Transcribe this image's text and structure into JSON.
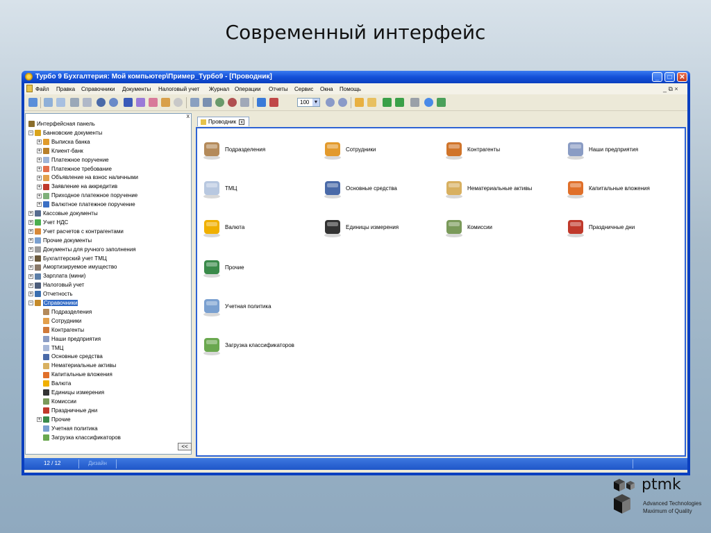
{
  "slide": {
    "title": "Современный интерфейс"
  },
  "window": {
    "title": "Турбо 9 Бухгалтерия: Мой компьютер\\Пример_Турбо9 - [Проводник]",
    "buttons": {
      "minimize": "_",
      "maximize": "□",
      "close": "✕"
    }
  },
  "menu": {
    "items": [
      "Файл",
      "Правка",
      "Справочники",
      "Документы",
      "Налоговый учет",
      "Журнал",
      "Операции",
      "Отчеты",
      "Сервис",
      "Окна",
      "Помощь"
    ],
    "mdi_controls": "_ ⧉ ×"
  },
  "toolbar": {
    "zoom_value": "100"
  },
  "tree": {
    "close_glyph": "x",
    "collapse_label": "<<",
    "nodes": [
      {
        "label": "Интерфейсная панель",
        "level": 0,
        "exp": "",
        "icon": "#8a6d2a"
      },
      {
        "label": "Банковские документы",
        "level": 0,
        "exp": "−",
        "icon": "#d9a41b"
      },
      {
        "label": "Выписка банка",
        "level": 1,
        "exp": "+",
        "icon": "#e09b2c"
      },
      {
        "label": "Клиент-банк",
        "level": 1,
        "exp": "+",
        "icon": "#b8802a"
      },
      {
        "label": "Платежное поручение",
        "level": 1,
        "exp": "+",
        "icon": "#9fb5d8"
      },
      {
        "label": "Платежное требование",
        "level": 1,
        "exp": "+",
        "icon": "#e3704c"
      },
      {
        "label": "Объявление на взнос наличными",
        "level": 1,
        "exp": "+",
        "icon": "#e3a04c"
      },
      {
        "label": "Заявление на аккредитив",
        "level": 1,
        "exp": "+",
        "icon": "#c0392b"
      },
      {
        "label": "Приходное платежное поручение",
        "level": 1,
        "exp": "+",
        "icon": "#7fb07a"
      },
      {
        "label": "Валютное платежное поручение",
        "level": 1,
        "exp": "+",
        "icon": "#3b6fc4"
      },
      {
        "label": "Кассовые документы",
        "level": 0,
        "exp": "+",
        "icon": "#556b8f"
      },
      {
        "label": "Учет НДС",
        "level": 0,
        "exp": "+",
        "icon": "#4caf50"
      },
      {
        "label": "Учет расчетов с контрагентами",
        "level": 0,
        "exp": "+",
        "icon": "#d88a3a"
      },
      {
        "label": "Прочие документы",
        "level": 0,
        "exp": "+",
        "icon": "#7aa0d0"
      },
      {
        "label": "Документы для ручного заполнения",
        "level": 0,
        "exp": "+",
        "icon": "#9a9a9a"
      },
      {
        "label": "Бухгалтерский учет ТМЦ",
        "level": 0,
        "exp": "+",
        "icon": "#6b5a3c"
      },
      {
        "label": "Амортизируемое имущество",
        "level": 0,
        "exp": "+",
        "icon": "#8a7a6a"
      },
      {
        "label": "Зарплата (мини)",
        "level": 0,
        "exp": "+",
        "icon": "#5d7fa8"
      },
      {
        "label": "Налоговый учет",
        "level": 0,
        "exp": "+",
        "icon": "#4d5d7a"
      },
      {
        "label": "Отчетность",
        "level": 0,
        "exp": "+",
        "icon": "#3a6fb0"
      },
      {
        "label": "Справочники",
        "level": 0,
        "exp": "−",
        "icon": "#c48a2a",
        "selected": true
      },
      {
        "label": "Подразделения",
        "level": 1,
        "exp": "",
        "icon": "#b48a5a"
      },
      {
        "label": "Сотрудники",
        "level": 1,
        "exp": "",
        "icon": "#e3a04c"
      },
      {
        "label": "Контрагенты",
        "level": 1,
        "exp": "",
        "icon": "#d07a3a"
      },
      {
        "label": "Наши предприятия",
        "level": 1,
        "exp": "",
        "icon": "#8a9cc4"
      },
      {
        "label": "ТМЦ",
        "level": 1,
        "exp": "",
        "icon": "#a8b8d8"
      },
      {
        "label": "Основные средства",
        "level": 1,
        "exp": "",
        "icon": "#4a6aa8"
      },
      {
        "label": "Нематериальные активы",
        "level": 1,
        "exp": "",
        "icon": "#d8b060"
      },
      {
        "label": "Капитальные вложения",
        "level": 1,
        "exp": "",
        "icon": "#e0702a"
      },
      {
        "label": "Валюта",
        "level": 1,
        "exp": "",
        "icon": "#f0b000"
      },
      {
        "label": "Единицы измерения",
        "level": 1,
        "exp": "",
        "icon": "#333333"
      },
      {
        "label": "Комиссии",
        "level": 1,
        "exp": "",
        "icon": "#7a9a5a"
      },
      {
        "label": "Праздничные дни",
        "level": 1,
        "exp": "",
        "icon": "#c0392b"
      },
      {
        "label": "Прочие",
        "level": 1,
        "exp": "+",
        "icon": "#3a8a4a"
      },
      {
        "label": "Учетная политика",
        "level": 1,
        "exp": "",
        "icon": "#7aa0d0"
      },
      {
        "label": "Загрузка классификаторов",
        "level": 1,
        "exp": "",
        "icon": "#6aa84f"
      }
    ]
  },
  "tab": {
    "label": "Проводник",
    "close": "x"
  },
  "explorer": {
    "items": [
      {
        "label": "Подразделения",
        "icon_name": "departments-icon",
        "color": "#b48a5a"
      },
      {
        "label": "Сотрудники",
        "icon_name": "employees-icon",
        "color": "#e39a2c"
      },
      {
        "label": "Контрагенты",
        "icon_name": "contractors-icon",
        "color": "#d0742a"
      },
      {
        "label": "Наши предприятия",
        "icon_name": "factory-icon",
        "color": "#8a9cc4"
      },
      {
        "label": "ТМЦ",
        "icon_name": "cabinet-icon",
        "color": "#b8c8e0"
      },
      {
        "label": "Основные средства",
        "icon_name": "building-icon",
        "color": "#4a6aa8"
      },
      {
        "label": "Нематериальные активы",
        "icon_name": "scroll-icon",
        "color": "#d8b060"
      },
      {
        "label": "Капитальные вложения",
        "icon_name": "brick-wall-icon",
        "color": "#e0702a"
      },
      {
        "label": "Валюта",
        "icon_name": "currency-icon",
        "color": "#f0b000"
      },
      {
        "label": "Единицы измерения",
        "icon_name": "weight-icon",
        "color": "#333333"
      },
      {
        "label": "Комиссии",
        "icon_name": "commission-icon",
        "color": "#7a9a5a"
      },
      {
        "label": "Праздничные дни",
        "icon_name": "calendar-icon",
        "color": "#c0392b"
      },
      {
        "label": "Прочие",
        "icon_name": "books-icon",
        "color": "#3a8a4a"
      },
      {
        "label": "Учетная политика",
        "icon_name": "open-book-icon",
        "color": "#7aa0d0"
      },
      {
        "label": "Загрузка классификаторов",
        "icon_name": "download-box-icon",
        "color": "#6aa84f"
      }
    ]
  },
  "status": {
    "page": "12 / 12",
    "mode": "Дизайн"
  },
  "logo": {
    "name": "ptmk",
    "tagline1": "Advanced Technologies",
    "tagline2": "Maximum of Quality"
  }
}
